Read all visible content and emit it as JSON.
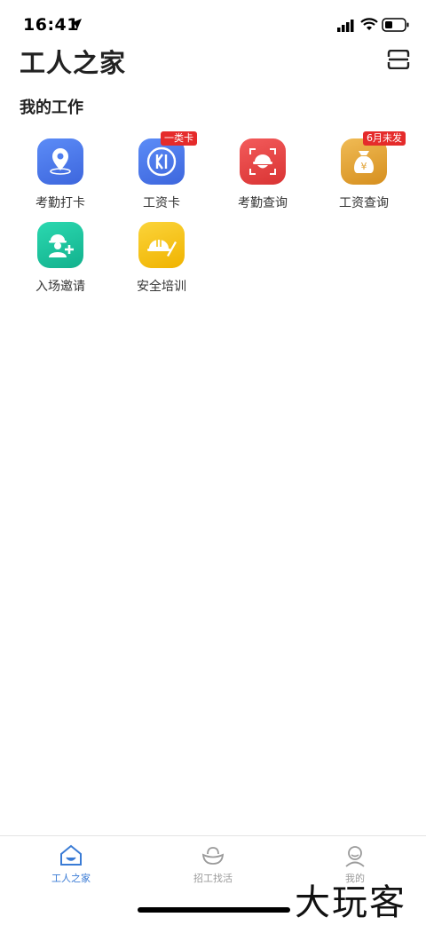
{
  "status_bar": {
    "time": "16:41"
  },
  "header": {
    "title": "工人之家"
  },
  "section": {
    "title": "我的工作"
  },
  "tiles": [
    {
      "label": "考勤打卡",
      "icon": "location-pin-icon",
      "color": "#4f7ef0"
    },
    {
      "label": "工资卡",
      "icon": "wage-card-icon",
      "color": "#4f7ef0",
      "badge": "一类卡"
    },
    {
      "label": "考勤查询",
      "icon": "hardhat-scan-icon",
      "color": "#ec4242"
    },
    {
      "label": "工资查询",
      "icon": "money-bag-icon",
      "color": "#e6a533",
      "badge": "6月未发"
    },
    {
      "label": "入场邀请",
      "icon": "worker-add-icon",
      "color": "#1ec8a2"
    },
    {
      "label": "安全培训",
      "icon": "hardhat-pen-icon",
      "color": "#f5c514"
    }
  ],
  "tab_bar": {
    "tabs": [
      {
        "label": "工人之家",
        "active": true
      },
      {
        "label": "招工找活",
        "active": false
      },
      {
        "label": "我的",
        "active": false
      }
    ],
    "active_color": "#3a7bd5"
  },
  "watermark": "大玩客"
}
